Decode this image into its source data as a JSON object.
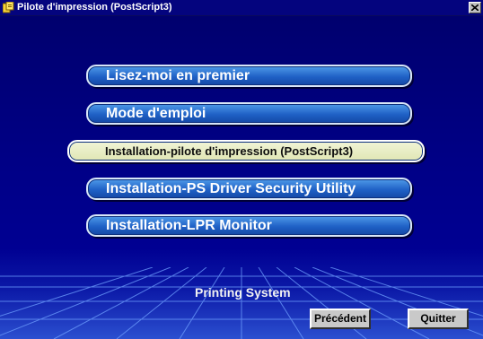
{
  "window": {
    "title": "Pilote d'impression (PostScript3)",
    "close_label": "×"
  },
  "menu": {
    "items": [
      {
        "label": "Lisez-moi en premier",
        "selected": false
      },
      {
        "label": "Mode d'emploi",
        "selected": false
      },
      {
        "label": "Installation-pilote d'impression (PostScript3)",
        "selected": true
      },
      {
        "label": "Installation-PS Driver Security Utility",
        "selected": false
      },
      {
        "label": "Installation-LPR Monitor",
        "selected": false
      }
    ]
  },
  "footer": {
    "label": "Printing System",
    "back_label": "Précédent",
    "quit_label": "Quitter"
  },
  "colors": {
    "background": "#00007e",
    "button_blue": "#1f61c6",
    "button_selected": "#e0e6b4",
    "grid_line": "#6fa0ff"
  },
  "icons": [
    "app-printer-icon",
    "close-icon"
  ]
}
